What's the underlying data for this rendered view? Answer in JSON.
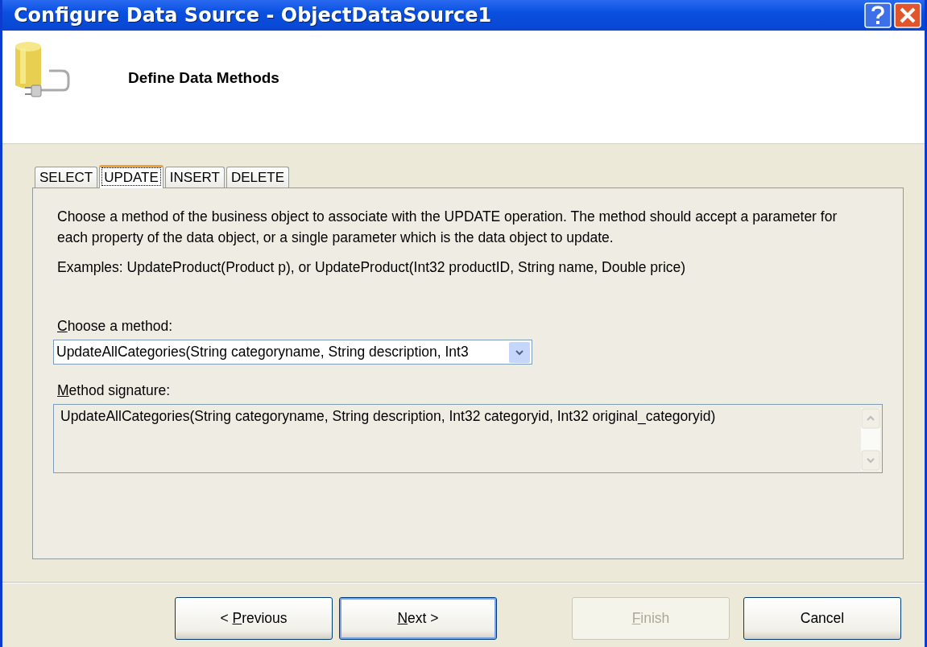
{
  "window": {
    "title": "Configure Data Source - ObjectDataSource1"
  },
  "header": {
    "title": "Define Data Methods"
  },
  "tabs": [
    {
      "label": "SELECT",
      "selected": false
    },
    {
      "label": "UPDATE",
      "selected": true
    },
    {
      "label": "INSERT",
      "selected": false
    },
    {
      "label": "DELETE",
      "selected": false
    }
  ],
  "description": "Choose a method of the business object to associate with the UPDATE operation. The method should accept a parameter for each property of the data object, or a single parameter which is the data object to update.",
  "examples": "Examples: UpdateProduct(Product p), or UpdateProduct(Int32 productID, String name, Double price)",
  "method_label": {
    "mnemonic": "C",
    "rest": "hoose a method:"
  },
  "method_dropdown": {
    "value": "UpdateAllCategories(String categoryname, String description, Int3"
  },
  "signature_label": {
    "mnemonic": "M",
    "rest": "ethod signature:"
  },
  "signature": {
    "value": "UpdateAllCategories(String categoryname, String description, Int32 categoryid, Int32 original_categoryid)"
  },
  "buttons": [
    {
      "before": "< ",
      "mnemonic": "P",
      "rest": "revious",
      "disabled": false,
      "default": false
    },
    {
      "mnemonic": "N",
      "rest": "ext >",
      "disabled": false,
      "default": true
    },
    {
      "mnemonic": "F",
      "rest": "inish",
      "disabled": true,
      "default": false
    },
    {
      "rest": "Cancel",
      "disabled": false,
      "default": false
    }
  ]
}
